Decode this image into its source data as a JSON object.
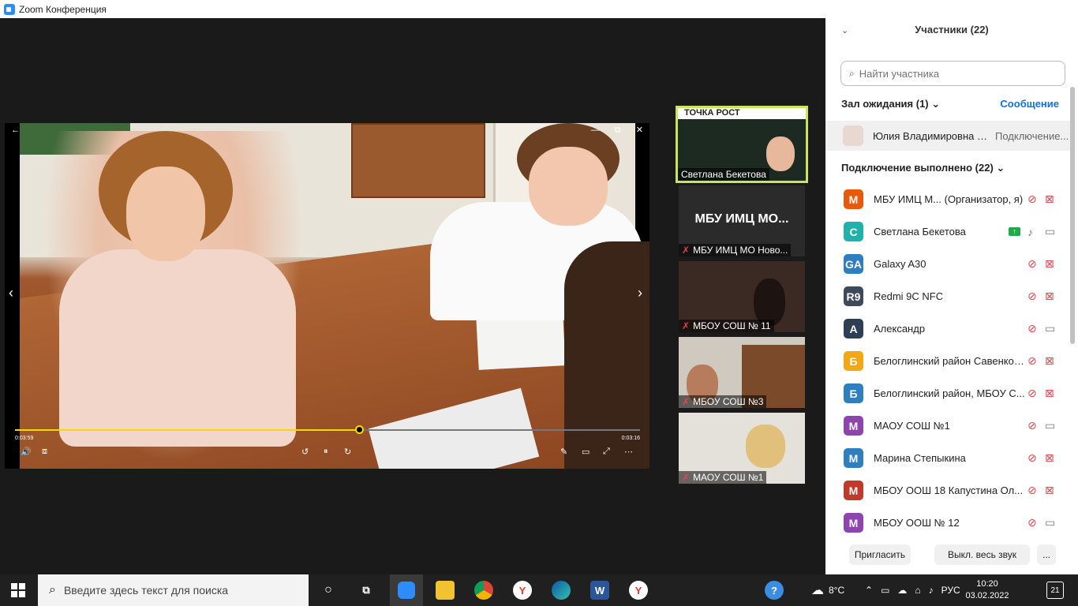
{
  "window": {
    "title": "Zoom Конференция",
    "controls": {
      "minimize": "—",
      "maximize": "❐",
      "close": "✕"
    }
  },
  "video_player": {
    "back_label": "←",
    "win_controls": [
      "—",
      "⧉",
      "✕"
    ],
    "time_elapsed": "0:03:59",
    "time_total": "0:03:16",
    "progress": 0.55,
    "prev_label": "‹",
    "next_label": "›",
    "controls": {
      "volume": "🔊",
      "subtitles": "⧈",
      "rewind": "↺",
      "pause": "⏸",
      "forward": "↻",
      "draw": "✎",
      "miniview": "▭",
      "fullscreen": "⤢",
      "more": "⋯"
    }
  },
  "thumbnails": [
    {
      "name": "Светлана Бекетова",
      "active": true,
      "muted": false,
      "banner": "ТОЧКА РОСТ"
    },
    {
      "name": "МБУ ИМЦ МО Ново...",
      "big_text": "МБУ ИМЦ МО...",
      "muted": true
    },
    {
      "name": "МБОУ СОШ № 11",
      "muted": true
    },
    {
      "name": "МБОУ СОШ №3",
      "muted": true
    },
    {
      "name": "МАОУ СОШ №1",
      "muted": true
    }
  ],
  "participants_panel": {
    "collapse_icon": "chevron-down-icon",
    "title": "Участники (22)",
    "search_placeholder": "Найти участника",
    "waiting_room": {
      "title": "Зал ожидания (1)",
      "message_label": "Сообщение",
      "person": {
        "name": "Юлия Владимировна Сол...",
        "status": "Подключение..."
      }
    },
    "connected_title": "Подключение выполнено (22)",
    "participants": [
      {
        "initials": "M",
        "color": "#e8590c",
        "name": "МБУ ИМЦ М... (Организатор, я)",
        "mic_muted": true,
        "cam_off": true,
        "sharing": false
      },
      {
        "initials": "C",
        "color": "#20b2aa",
        "name": "Светлана Бекетова",
        "mic_muted": false,
        "cam_off": false,
        "sharing": true
      },
      {
        "initials": "GA",
        "color": "#2f7fbf",
        "name": "Galaxy A30",
        "mic_muted": true,
        "cam_off": true,
        "sharing": false
      },
      {
        "initials": "R9",
        "color": "#3d4a5c",
        "name": "Redmi 9C NFC",
        "mic_muted": true,
        "cam_off": true,
        "sharing": false
      },
      {
        "initials": "A",
        "color": "#2d3e55",
        "name": "Александр",
        "mic_muted": true,
        "cam_off": false,
        "sharing": false
      },
      {
        "initials": "Б",
        "color": "#f5a614",
        "name": "Белоглинский район Савенко Т...",
        "mic_muted": true,
        "cam_off": true,
        "sharing": false
      },
      {
        "initials": "Б",
        "color": "#2f7fbf",
        "name": "Белоглинский район, МБОУ С...",
        "mic_muted": true,
        "cam_off": true,
        "sharing": false
      },
      {
        "initials": "M",
        "color": "#8e44ad",
        "name": "МАОУ СОШ №1",
        "mic_muted": true,
        "cam_off": false,
        "sharing": false
      },
      {
        "initials": "M",
        "color": "#2f7fbf",
        "name": "Марина Степыкина",
        "mic_muted": true,
        "cam_off": true,
        "sharing": false
      },
      {
        "initials": "M",
        "color": "#c0392b",
        "name": "МБОУ ООШ 18 Капустина Ол...",
        "mic_muted": true,
        "cam_off": true,
        "sharing": false
      },
      {
        "initials": "M",
        "color": "#8e44ad",
        "name": "МБОУ ООШ № 12",
        "mic_muted": true,
        "cam_off": false,
        "sharing": false
      }
    ],
    "buttons": {
      "invite": "Пригласить",
      "mute_all": "Выкл. весь звук",
      "more": "..."
    }
  },
  "taskbar": {
    "search_placeholder": "Введите здесь текст для поиска",
    "weather": "8°C",
    "language": "РУС",
    "time": "10:20",
    "date": "03.02.2022",
    "notifications": "21",
    "apps": [
      "cortana-icon",
      "task-view-icon",
      "zoom-icon",
      "file-explorer-icon",
      "chrome-icon",
      "yandex-browser-icon",
      "edge-icon",
      "word-icon",
      "yandex-icon"
    ]
  }
}
